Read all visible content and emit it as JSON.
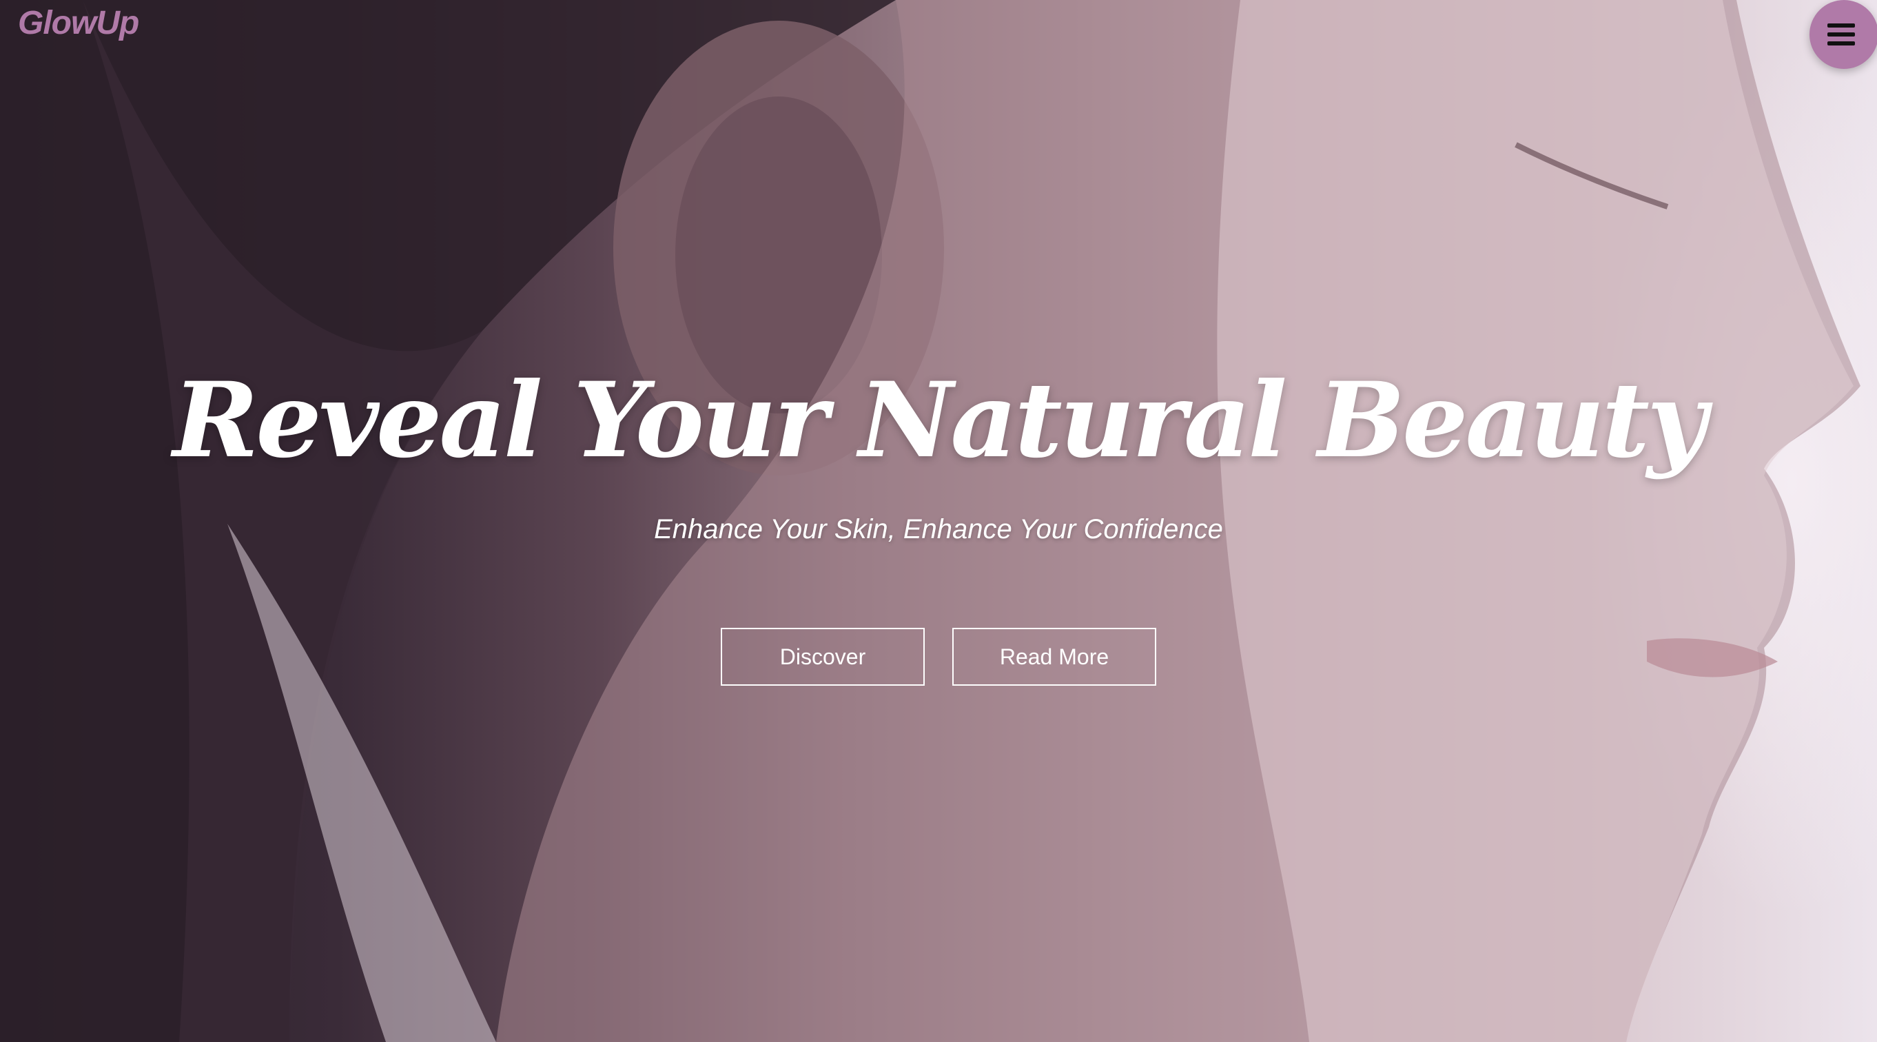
{
  "brand": {
    "name": "GlowUp",
    "color": "#b07aa8"
  },
  "menu": {
    "icon": "hamburger-menu-icon",
    "button_color": "#b07aa8"
  },
  "hero": {
    "title": "Reveal Your Natural Beauty",
    "subtitle": "Enhance Your Skin, Enhance Your Confidence",
    "background_image": "profile-portrait-photo",
    "buttons": {
      "discover_label": "Discover",
      "read_more_label": "Read More"
    }
  }
}
